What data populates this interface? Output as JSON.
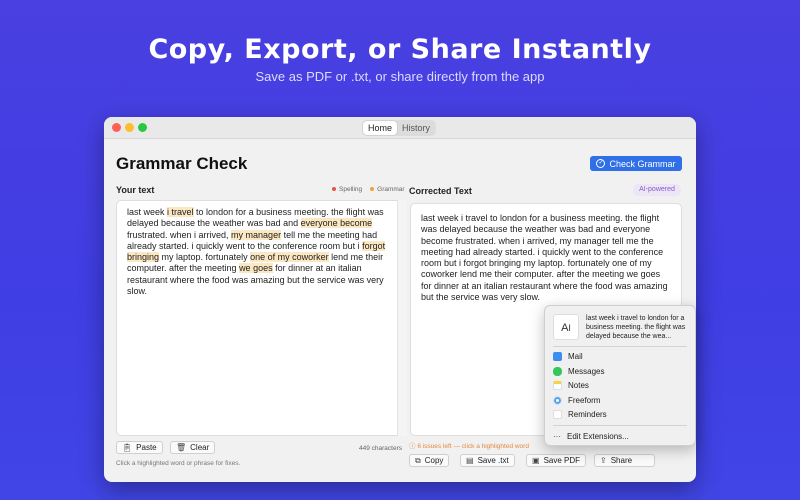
{
  "hero": {
    "title": "Copy, Export, or Share Instantly",
    "subtitle": "Save as PDF or .txt, or share directly from the app"
  },
  "window": {
    "tabs": [
      "Home",
      "History"
    ],
    "active_tab": "Home"
  },
  "app": {
    "title": "Grammar Check",
    "check_button": "Check Grammar"
  },
  "left_panel": {
    "label": "Your text",
    "legend": [
      {
        "label": "Spelling",
        "color": "#e8553f"
      },
      {
        "label": "Grammar",
        "color": "#f0a23a"
      }
    ],
    "segments": [
      {
        "text": "last week ",
        "hl": false
      },
      {
        "text": "i travel",
        "hl": true
      },
      {
        "text": " to london for a business meeting. the flight was delayed because the weather was bad and ",
        "hl": false
      },
      {
        "text": "everyone become",
        "hl": true
      },
      {
        "text": " frustrated. when i arrived, ",
        "hl": false
      },
      {
        "text": "my manager",
        "hl": true
      },
      {
        "text": " tell me the meeting had already started. i quickly went to the conference room but i ",
        "hl": false
      },
      {
        "text": "forgot bringing",
        "hl": true
      },
      {
        "text": " my laptop. fortunately ",
        "hl": false
      },
      {
        "text": "one of my coworker",
        "hl": true
      },
      {
        "text": " lend me their computer. after the meeting ",
        "hl": false
      },
      {
        "text": "we goes",
        "hl": true
      },
      {
        "text": " for dinner at an italian restaurant where the food was amazing but the service was very slow.",
        "hl": false
      }
    ],
    "paste_label": "Paste",
    "clear_label": "Clear",
    "char_count": "449 characters",
    "hint": "Click a highlighted word or phrase for fixes."
  },
  "right_panel": {
    "label": "Corrected Text",
    "badge": "AI-powered",
    "text": "last week i travel to london for a business meeting. the flight was delayed because the weather was bad and everyone become frustrated. when i arrived, my manager tell me the meeting had already started. i quickly went to the conference room but i forgot bringing my laptop. fortunately one of my coworker lend me their computer. after the meeting we goes for dinner at an italian restaurant where the food was amazing but the service was very slow.",
    "issues": "6 issues left — click a highlighted word",
    "actions": {
      "copy": "Copy",
      "save_txt": "Save .txt",
      "save_pdf": "Save PDF",
      "share": "Share"
    }
  },
  "share_menu": {
    "preview": "last week i travel to london for a business meeting. the flight was delayed because the wea...",
    "items": [
      {
        "label": "Mail",
        "icon": "mail-icon",
        "color": "#3b8ef0"
      },
      {
        "label": "Messages",
        "icon": "messages-icon",
        "color": "#34c759"
      },
      {
        "label": "Notes",
        "icon": "notes-icon",
        "color": "#f5d547"
      },
      {
        "label": "Freeform",
        "icon": "freeform-icon",
        "color": "#4aa3f7"
      },
      {
        "label": "Reminders",
        "icon": "reminders-icon",
        "color": "#ffffff"
      }
    ],
    "edit_label": "Edit Extensions..."
  },
  "colors": {
    "background": "#4140e2",
    "accent": "#2f6fe8",
    "highlight": "#fbe7c2",
    "issues": "#e6883d"
  }
}
